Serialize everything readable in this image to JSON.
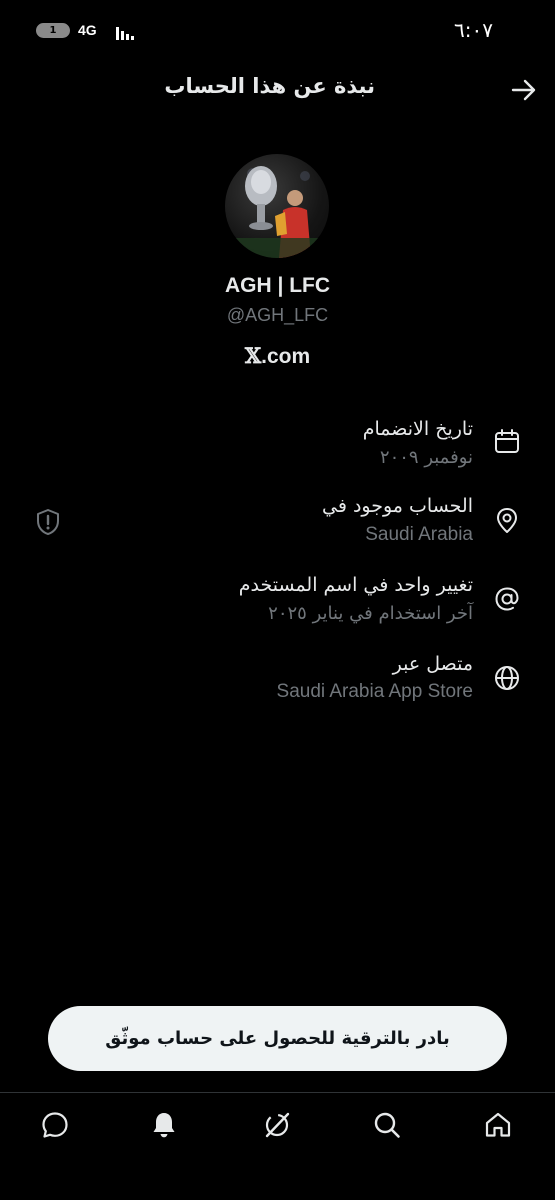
{
  "status_bar": {
    "battery_level": "1",
    "network": "4G",
    "time": "٦:٠٧"
  },
  "header": {
    "title": "نبذة عن هذا الحساب",
    "back_icon": "arrow-right-icon"
  },
  "profile": {
    "display_name": "AGH | LFC",
    "username": "@AGH_LFC",
    "site_logo": "𝕏",
    "site_domain": ".com"
  },
  "info": {
    "joined": {
      "title": "تاريخ الانضمام",
      "value": "نوفمبر ٢٠٠٩",
      "icon": "calendar-icon"
    },
    "location": {
      "title": "الحساب موجود في",
      "value": "Saudi Arabia",
      "icon": "location-pin-icon",
      "side_icon": "shield-alert-icon"
    },
    "username_changes": {
      "title": "تغيير واحد في اسم المستخدم",
      "value": "آخر استخدام في يناير ٢٠٢٥",
      "icon": "at-sign-icon"
    },
    "connected_via": {
      "title": "متصل عبر",
      "value": "Saudi Arabia App Store",
      "icon": "globe-icon"
    }
  },
  "upgrade": {
    "label": "بادر بالترقية للحصول على حساب موثّق"
  },
  "bottom_nav": {
    "items": [
      "messages-icon",
      "notifications-icon",
      "grok-icon",
      "search-icon",
      "home-icon"
    ]
  },
  "colors": {
    "background": "#000000",
    "text_primary": "#e7e9ea",
    "text_secondary": "#71767b",
    "pill_background": "#eff3f4"
  }
}
